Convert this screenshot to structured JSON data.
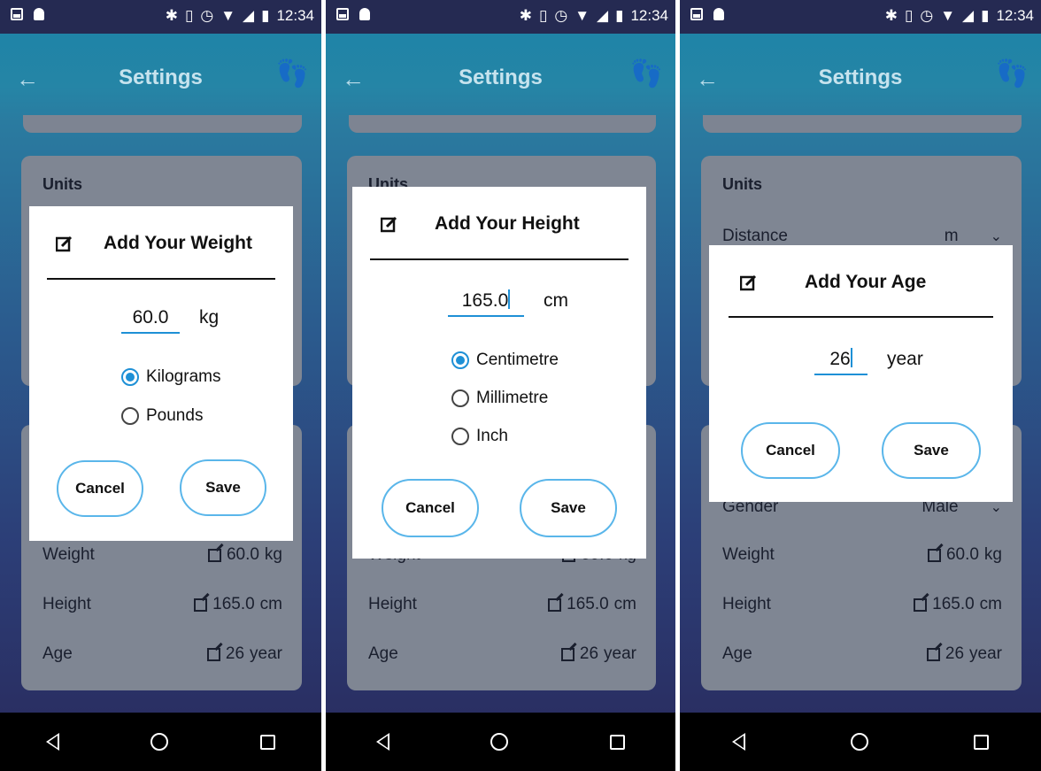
{
  "status": {
    "time": "12:34"
  },
  "app": {
    "title": "Settings"
  },
  "units": {
    "title": "Units",
    "distance_label": "Distance",
    "distance_value": "m",
    "gender_label": "Gender",
    "gender_value": "Male"
  },
  "profile": {
    "weight_label": "Weight",
    "weight_value": "60.0",
    "weight_unit": "kg",
    "height_label": "Height",
    "height_value": "165.0",
    "height_unit": "cm",
    "age_label": "Age",
    "age_value": "26",
    "age_unit": "year"
  },
  "dialogs": {
    "cancel": "Cancel",
    "save": "Save",
    "weight": {
      "title": "Add Your Weight",
      "value": "60.0",
      "unit": "kg",
      "options": [
        "Kilograms",
        "Pounds"
      ],
      "selected": "Kilograms"
    },
    "height": {
      "title": "Add Your Height",
      "value": "165.0",
      "unit": "cm",
      "options": [
        "Centimetre",
        "Millimetre",
        "Inch"
      ],
      "selected": "Centimetre"
    },
    "age": {
      "title": "Add Your Age",
      "value": "26",
      "unit": "year"
    }
  },
  "colors": {
    "accent": "#1e90d6",
    "button_border": "#5ab6ea",
    "appbar": "#2585a6",
    "card": "#7f8693"
  },
  "icons": [
    "image-icon",
    "android-icon",
    "bluetooth-icon",
    "vibrate-icon",
    "alarm-icon",
    "wifi-icon",
    "signal-icon",
    "battery-icon",
    "back-arrow-icon",
    "footsteps-icon",
    "edit-icon",
    "nav-back-icon",
    "nav-home-icon",
    "nav-recents-icon"
  ]
}
